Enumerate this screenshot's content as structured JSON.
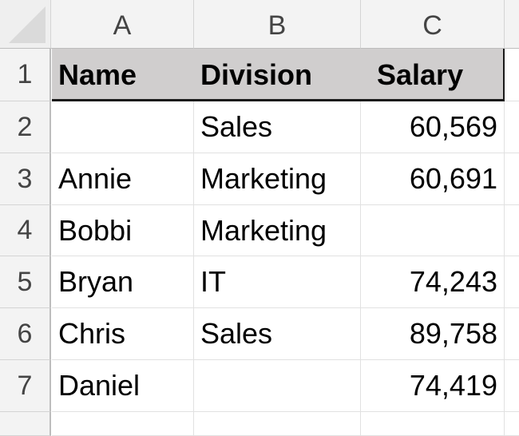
{
  "sheet": {
    "column_headers": [
      "A",
      "B",
      "C"
    ],
    "row_numbers": [
      "1",
      "2",
      "3",
      "4",
      "5",
      "6",
      "7"
    ],
    "header_row": {
      "name": "Name",
      "division": "Division",
      "salary": "Salary"
    },
    "rows": [
      {
        "name": "",
        "division": "Sales",
        "salary": "60,569"
      },
      {
        "name": "Annie",
        "division": "Marketing",
        "salary": "60,691"
      },
      {
        "name": "Bobbi",
        "division": "Marketing",
        "salary": ""
      },
      {
        "name": "Bryan",
        "division": "IT",
        "salary": "74,243"
      },
      {
        "name": "Chris",
        "division": "Sales",
        "salary": "89,758"
      },
      {
        "name": "Daniel",
        "division": "",
        "salary": "74,419"
      }
    ],
    "colors": {
      "header_fill": "#d0cece",
      "header_border": "#1a1a1a",
      "gridline": "#e1e1e1",
      "headings_bg": "#f3f3f3"
    }
  }
}
